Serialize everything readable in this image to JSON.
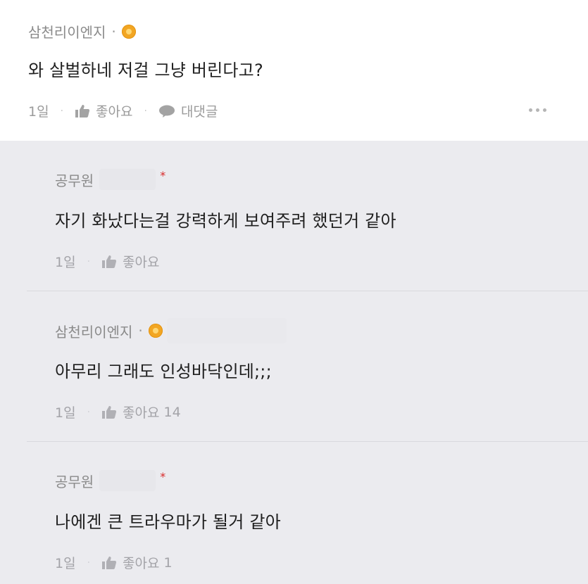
{
  "main_comment": {
    "author": "삼천리이엔지",
    "text": "와 살벌하네 저걸 그냥 버린다고?",
    "time": "1일",
    "like_label": "좋아요",
    "reply_label": "대댓글"
  },
  "replies": [
    {
      "author": "공무원",
      "text": "자기 화났다는걸 강력하게 보여주려 했던거 같아",
      "time": "1일",
      "like_label": "좋아요",
      "like_count": ""
    },
    {
      "author": "삼천리이엔지",
      "text": "아무리 그래도 인성바닥인데;;;",
      "time": "1일",
      "like_label": "좋아요",
      "like_count": "14"
    },
    {
      "author": "공무원",
      "text": "나에겐 큰 트라우마가 될거 같아",
      "time": "1일",
      "like_label": "좋아요",
      "like_count": "1"
    }
  ],
  "colors": {
    "badge": "#f2a623",
    "reply_background": "#ebebef",
    "author_star": "#d82a2a"
  },
  "icons": {
    "like": "thumbs-up-icon",
    "reply": "speech-bubble-icon",
    "more": "more-dots-icon",
    "badge": "gold-badge-icon"
  }
}
